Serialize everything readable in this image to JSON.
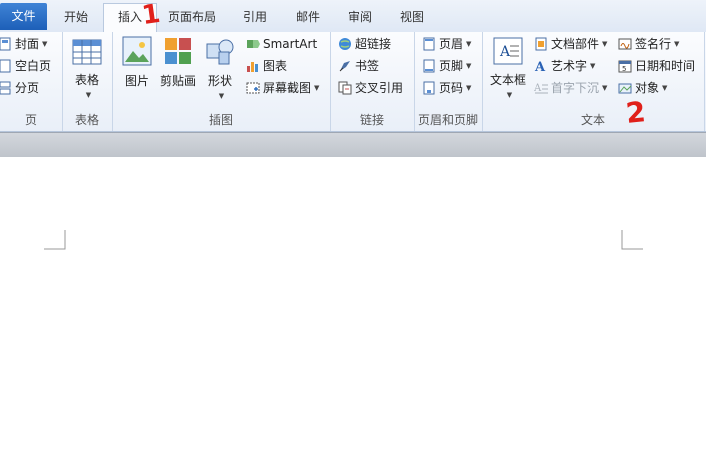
{
  "tabs": [
    "文件",
    "开始",
    "插入",
    "页面布局",
    "引用",
    "邮件",
    "审阅",
    "视图"
  ],
  "active_tab": "插入",
  "groups": {
    "pages": {
      "label": "页",
      "items": [
        "封面",
        "空白页",
        "分页"
      ]
    },
    "table": {
      "label": "表格",
      "button": "表格"
    },
    "illustrations": {
      "label": "插图",
      "picture": "图片",
      "clipart": "剪贴画",
      "shapes": "形状",
      "smartart": "SmartArt",
      "chart": "图表",
      "screenshot": "屏幕截图"
    },
    "links": {
      "label": "链接",
      "hyperlink": "超链接",
      "bookmark": "书签",
      "crossref": "交叉引用"
    },
    "header_footer": {
      "label": "页眉和页脚",
      "header": "页眉",
      "footer": "页脚",
      "page_number": "页码"
    },
    "text": {
      "label": "文本",
      "textbox": "文本框",
      "quickparts": "文档部件",
      "wordart": "艺术字",
      "dropcap": "首字下沉",
      "signature": "签名行",
      "datetime": "日期和时间",
      "object": "对象"
    }
  },
  "annotations": [
    "1",
    "2"
  ],
  "colors": {
    "accent": "#1d5fb8",
    "annotation": "#e0201b"
  }
}
